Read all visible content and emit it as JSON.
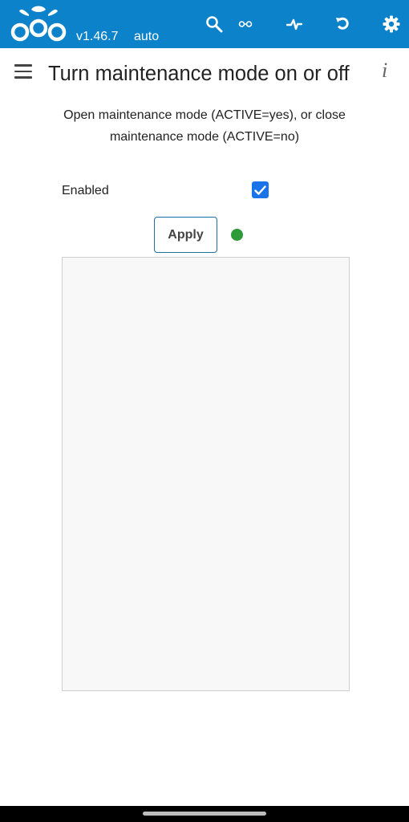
{
  "header": {
    "logo": "raspberry-logo",
    "version": "v1.46.7",
    "mode": "auto",
    "icons": [
      "search-icon",
      "infinity-icon",
      "pulse-icon",
      "refresh-icon",
      "gear-icon"
    ],
    "background": "#0b82c9"
  },
  "page": {
    "title": "Turn maintenance mode on or off",
    "info": "i",
    "description": "Open maintenance mode (ACTIVE=yes), or close maintenance mode (ACTIVE=no)"
  },
  "form": {
    "enabled_label": "Enabled",
    "enabled_checked": true,
    "apply_label": "Apply",
    "status_color": "#2e9a3a",
    "output_text": ""
  }
}
